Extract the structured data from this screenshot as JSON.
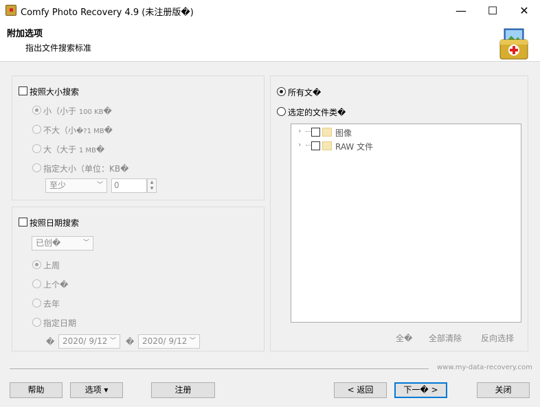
{
  "window": {
    "title": "Comfy Photo Recovery 4.9 (未注册版�)",
    "minimize_glyph": "—",
    "maximize_glyph": "☐",
    "close_glyph": "✕"
  },
  "header": {
    "title": "附加选项",
    "subtitle": "指出文件搜索标准",
    "logo_icon": "first-aid-kit-photo-icon"
  },
  "size_search": {
    "checkbox_label": "按照大小搜索",
    "checked": false,
    "options": [
      {
        "prefix": "小（小于 ",
        "size": "100 KB",
        "suffix": "�",
        "selected": true
      },
      {
        "prefix": "不大（小",
        "size": "�?1 MB",
        "suffix": "�",
        "selected": false
      },
      {
        "prefix": "大（大于 ",
        "size": "1 MB",
        "suffix": "�",
        "selected": false
      },
      {
        "prefix": "指定大小（单位：KB",
        "size": "",
        "suffix": "�",
        "selected": false
      }
    ],
    "min_combo_value": "至少",
    "min_value": "0"
  },
  "date_search": {
    "checkbox_label": "按照日期搜索",
    "checked": false,
    "type_combo_value": "已创�",
    "options": [
      {
        "label": "上周",
        "selected": true
      },
      {
        "label": "上个�",
        "selected": false
      },
      {
        "label": "去年",
        "selected": false
      },
      {
        "label": "指定日期",
        "selected": false
      }
    ],
    "from_prefix": "�",
    "from_date": "2020/  9/12",
    "to_prefix": "�",
    "to_date": "2020/  9/12"
  },
  "file_types": {
    "all_label": "所有文�",
    "all_selected": true,
    "selected_label": "选定的文件类�",
    "tree": [
      {
        "label": "图像",
        "checked": false
      },
      {
        "label": "RAW 文件",
        "checked": false
      }
    ],
    "select_all": "全�",
    "clear_all": "全部清除",
    "invert": "反向选择"
  },
  "footer": {
    "watermark": "www.my-data-recovery.com",
    "help": "帮助",
    "options": "选项 ▾",
    "register": "注册",
    "back": "< 返回",
    "next": "下一� >",
    "close": "关闭"
  }
}
